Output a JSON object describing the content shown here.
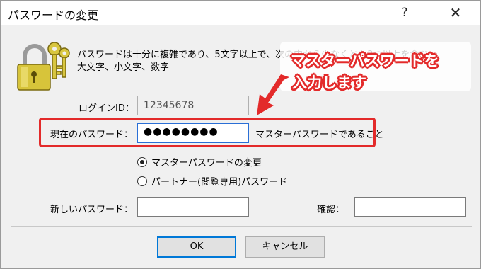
{
  "window": {
    "title": "パスワードの変更",
    "help_glyph": "?",
    "close_glyph": "✕"
  },
  "description": "パスワードは十分に複雑であり、5文字以上で、次の中から少なくとも3つ以上を含む…\n大文字、小文字、数字",
  "login": {
    "label": "ログインID：",
    "value": "12345678"
  },
  "current_password": {
    "label": "現在のパスワード：",
    "mask": "●●●●●●●●",
    "note": "マスターパスワードであること"
  },
  "radios": [
    {
      "label": "マスターパスワードの変更",
      "checked": true
    },
    {
      "label": "パートナー(閲覧専用)パスワード",
      "checked": false
    }
  ],
  "new_password": {
    "label": "新しいパスワード：",
    "value": ""
  },
  "confirm": {
    "label": "確認：",
    "value": ""
  },
  "buttons": {
    "ok": "OK",
    "cancel": "キャンセル"
  },
  "annotation": {
    "line1": "マスターパスワードを",
    "line2": "入力します",
    "color": "#e32a2a"
  },
  "icons": {
    "lock": "padlock-keys-icon",
    "arrow": "red-arrow-icon"
  }
}
